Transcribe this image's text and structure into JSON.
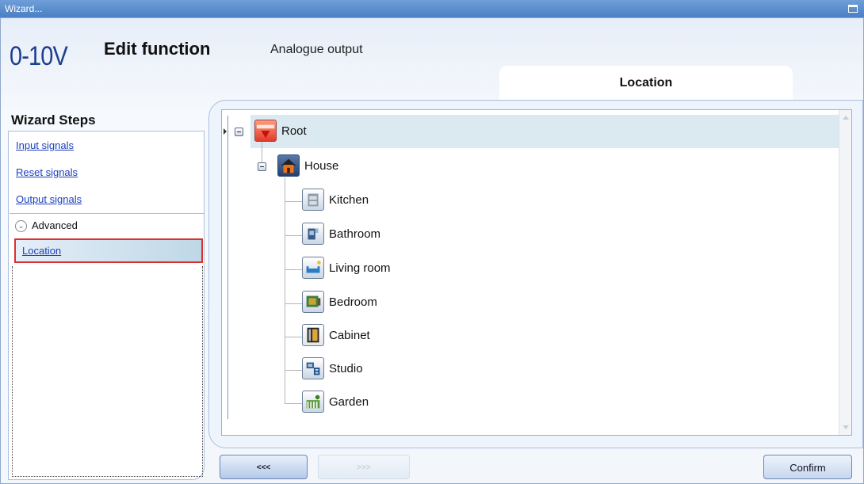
{
  "window": {
    "title": "Wizard..."
  },
  "header": {
    "logo_text": "0-10V",
    "title": "Edit function",
    "subtitle": "Analogue output"
  },
  "tabs": [
    {
      "label": "Location"
    }
  ],
  "wizard_steps": {
    "title": "Wizard Steps",
    "items": [
      {
        "label": "Input signals"
      },
      {
        "label": "Reset signals"
      },
      {
        "label": "Output signals"
      }
    ],
    "advanced": {
      "label": "Advanced",
      "items": [
        {
          "label": "Location",
          "selected": true
        }
      ]
    }
  },
  "tree": {
    "root": {
      "label": "Root",
      "icon": "company-logo-icon",
      "expanded": true
    },
    "house": {
      "label": "House",
      "icon": "house-icon",
      "expanded": true
    },
    "rooms": [
      {
        "label": "Kitchen",
        "icon": "kitchen-icon"
      },
      {
        "label": "Bathroom",
        "icon": "bathroom-icon"
      },
      {
        "label": "Living room",
        "icon": "living-room-icon"
      },
      {
        "label": "Bedroom",
        "icon": "bedroom-icon"
      },
      {
        "label": "Cabinet",
        "icon": "cabinet-icon"
      },
      {
        "label": "Studio",
        "icon": "studio-icon"
      },
      {
        "label": "Garden",
        "icon": "garden-icon"
      }
    ]
  },
  "buttons": {
    "back": "<<<",
    "next": ">>>",
    "confirm": "Confirm"
  },
  "colors": {
    "accent": "#4a7fc4",
    "link": "#1b3fbf",
    "selection_border": "#d93030",
    "root_highlight": "#dbe9f1"
  }
}
